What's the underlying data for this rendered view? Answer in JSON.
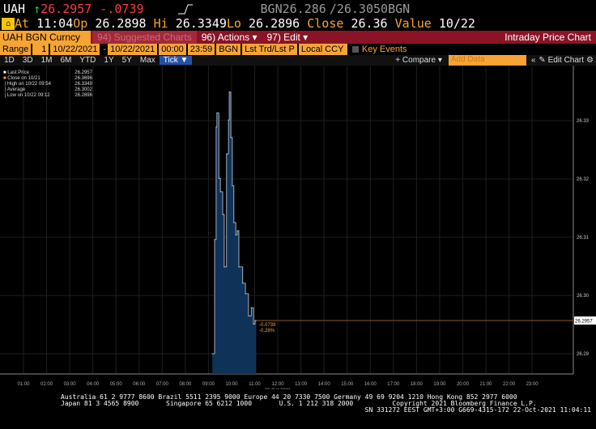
{
  "header": {
    "ticker": "UAH",
    "arrow": "↑",
    "last": "26.2957",
    "change": "-.0739",
    "bid_label": "BGN",
    "bid": "26.286",
    "sep": "/",
    "ask": "26.3050",
    "ask_label": "BGN"
  },
  "quote": {
    "at_label": "At",
    "time": "11:04",
    "op_label": "Op",
    "op": "26.2898",
    "hi_label": "Hi",
    "hi": "26.3349",
    "lo_label": "Lo",
    "lo": "26.2896",
    "close_label": "Close",
    "close": "26.36",
    "value_label": "Value",
    "value": "10/22"
  },
  "toolbar": {
    "security": "UAH BGN Curncy",
    "suggested": "94) Suggested Charts",
    "actions": "96) Actions ▾",
    "edit": "97) Edit ▾",
    "title": "Intraday Price Chart"
  },
  "range": {
    "label": "Range",
    "days": "1",
    "start": "10/22/2021",
    "dash": "-",
    "end": "10/22/2021",
    "t_start": "00:00",
    "t_end": "23:59",
    "source": "BGN",
    "mode": "Lst Trd/Lst P",
    "ccy": "Local CCY",
    "key_events": "Key Events"
  },
  "periods": {
    "tabs": [
      "1D",
      "3D",
      "1M",
      "6M",
      "YTD",
      "1Y",
      "5Y",
      "Max"
    ],
    "active": "Tick ▼",
    "compare": "+ Compare ▾",
    "add_data_placeholder": "Add Data",
    "collapse": "«",
    "edit_chart": "✎ Edit Chart",
    "settings": "⚙"
  },
  "legend": [
    {
      "label": "Last Price",
      "value": "26.2957",
      "color": "#ffffff"
    },
    {
      "label": "Close on 10/21",
      "value": "26.3696",
      "color": "#f7a434"
    },
    {
      "label": "High on 10/22 09:54",
      "value": "26.3349"
    },
    {
      "label": "Average",
      "value": "26.3002"
    },
    {
      "label": "Low on 10/22 09:12",
      "value": "26.2896"
    }
  ],
  "chart_data": {
    "type": "area",
    "ylim": [
      26.285,
      26.343
    ],
    "yticks": [
      "26.33",
      "26.32",
      "26.31",
      "26.30",
      "26.29"
    ],
    "xticks": [
      "01:00",
      "02:00",
      "03:00",
      "04:00",
      "05:00",
      "06:00",
      "07:00",
      "08:00",
      "09:00",
      "10:00",
      "11:00",
      "12:00",
      "13:00",
      "14:00",
      "15:00",
      "16:00",
      "17:00",
      "18:00",
      "19:00",
      "20:00",
      "21:00",
      "22:00",
      "23:00"
    ],
    "date_label": "22 Oct 2021",
    "last_price_label": "26.2957",
    "last_price": 26.2957,
    "change_label": "-0.0739",
    "pct_label": "-0.28%",
    "x": [
      "09:10",
      "09:16",
      "09:20",
      "09:22",
      "09:27",
      "09:31",
      "09:37",
      "09:41",
      "09:47",
      "09:52",
      "09:54",
      "09:58",
      "10:02",
      "10:06",
      "10:11",
      "10:15",
      "10:19",
      "10:29",
      "10:36",
      "10:44",
      "10:51",
      "10:57",
      "11:01",
      "11:04"
    ],
    "values": [
      26.29,
      26.3096,
      26.3289,
      26.3313,
      26.3201,
      26.3178,
      26.3139,
      26.3049,
      26.3243,
      26.3301,
      26.3349,
      26.3271,
      26.3188,
      26.3125,
      26.3104,
      26.3111,
      26.3049,
      26.3021,
      26.3003,
      26.2965,
      26.2979,
      26.2951,
      26.2957,
      26.2957
    ],
    "colors": {
      "fill": "#0f3358",
      "line": "#c8d0dc",
      "last": "#8a5a28"
    }
  },
  "footer": {
    "line1": "Australia 61 2 9777 8600 Brazil 5511 2395 9000 Europe 44 20 7330 7500 Germany 49 69 9204 1210 Hong Kong 852 2977 6000",
    "line2": "Japan 81 3 4565 8900       Singapore 65 6212 1000       U.S. 1 212 318 2000          Copyright 2021 Bloomberg Finance L.P.",
    "line3": "SN 331272 EEST GMT+3:00 G669-4315-172 22-Oct-2021 11:04:11"
  }
}
